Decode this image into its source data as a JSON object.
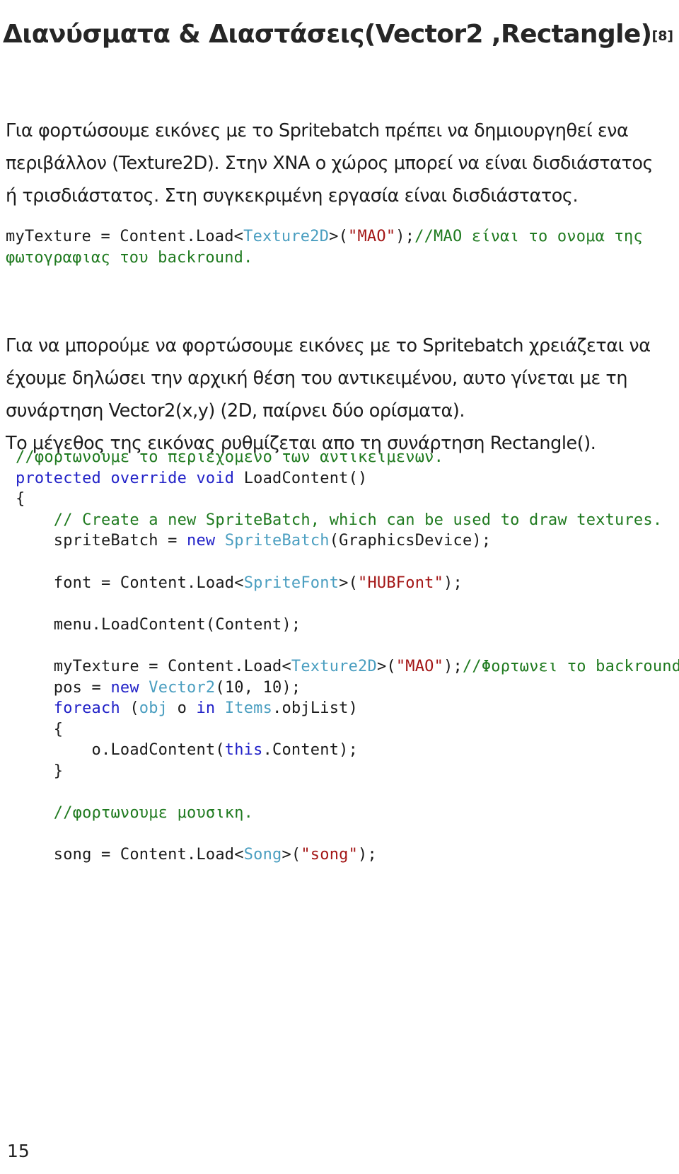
{
  "document": {
    "title": "Διανύσματα & Διαστάσεις(Vector2 ,Rectangle)",
    "title_reference": "[8]",
    "page_number": "15"
  },
  "paragraphs": {
    "p1": "Για φορτώσουμε εικόνες με το Spritebatch πρέπει να δημιουργηθεί ενα περιβάλλον (Texture2D). Στην ΧΝΑ ο χώρος μπορεί να είναι δισδιάστατος ή τρισδιάστατος. Στη συγκεκριμένη εργασία είναι δισδιάστατος.",
    "p2": "Για να μπορούμε να φορτώσουμε εικόνες με το Spritebatch χρειάζεται να έχουμε δηλώσει την αρχική θέση του αντικειμένου,  αυτο γίνεται με τη συνάρτηση Vector2(x,y) (2D, παίρνει δύο ορίσματα).",
    "p3": "Το μέγεθος της εικόνας ρυθμίζεται απο τη συνάρτηση Rectangle()."
  },
  "code_inline": {
    "tokens": [
      {
        "text": "myTexture = Content.Load<",
        "style": "plain"
      },
      {
        "text": "Texture2D",
        "style": "type"
      },
      {
        "text": ">(",
        "style": "plain"
      },
      {
        "text": "\"MAO\"",
        "style": "string"
      },
      {
        "text": ");",
        "style": "plain"
      },
      {
        "text": "//MAO είναι το ονομα της φωτογραφιας του backround.",
        "style": "comment"
      }
    ]
  },
  "code_main": {
    "lines": [
      [
        {
          "text": "//φορτωνουμε το περιεχομενο των αντικειμενων.",
          "style": "comment"
        }
      ],
      [
        {
          "text": "protected override void",
          "style": "keyword"
        },
        {
          "text": " LoadContent()",
          "style": "plain"
        }
      ],
      [
        {
          "text": "{",
          "style": "plain"
        }
      ],
      [
        {
          "text": "    // Create a new SpriteBatch, which can be used to draw textures.",
          "style": "comment"
        }
      ],
      [
        {
          "text": "    spriteBatch = ",
          "style": "plain"
        },
        {
          "text": "new",
          "style": "keyword"
        },
        {
          "text": " ",
          "style": "plain"
        },
        {
          "text": "SpriteBatch",
          "style": "type"
        },
        {
          "text": "(GraphicsDevice);",
          "style": "plain"
        }
      ],
      [
        {
          "text": "",
          "style": "plain"
        }
      ],
      [
        {
          "text": "    font = Content.Load<",
          "style": "plain"
        },
        {
          "text": "SpriteFont",
          "style": "type"
        },
        {
          "text": ">(",
          "style": "plain"
        },
        {
          "text": "\"HUBFont\"",
          "style": "string"
        },
        {
          "text": ");",
          "style": "plain"
        }
      ],
      [
        {
          "text": "",
          "style": "plain"
        }
      ],
      [
        {
          "text": "    menu.LoadContent(Content);",
          "style": "plain"
        }
      ],
      [
        {
          "text": "",
          "style": "plain"
        }
      ],
      [
        {
          "text": "    myTexture = Content.Load<",
          "style": "plain"
        },
        {
          "text": "Texture2D",
          "style": "type"
        },
        {
          "text": ">(",
          "style": "plain"
        },
        {
          "text": "\"MAO\"",
          "style": "string"
        },
        {
          "text": ");",
          "style": "plain"
        },
        {
          "text": "//Φορτωνει το backround.",
          "style": "comment"
        }
      ],
      [
        {
          "text": "    pos = ",
          "style": "plain"
        },
        {
          "text": "new",
          "style": "keyword"
        },
        {
          "text": " ",
          "style": "plain"
        },
        {
          "text": "Vector2",
          "style": "type"
        },
        {
          "text": "(10, 10);",
          "style": "plain"
        }
      ],
      [
        {
          "text": "    foreach",
          "style": "keyword"
        },
        {
          "text": " (",
          "style": "plain"
        },
        {
          "text": "obj",
          "style": "type"
        },
        {
          "text": " o ",
          "style": "plain"
        },
        {
          "text": "in",
          "style": "keyword"
        },
        {
          "text": " ",
          "style": "plain"
        },
        {
          "text": "Items",
          "style": "type"
        },
        {
          "text": ".objList)",
          "style": "plain"
        }
      ],
      [
        {
          "text": "    {",
          "style": "plain"
        }
      ],
      [
        {
          "text": "        o.LoadContent(",
          "style": "plain"
        },
        {
          "text": "this",
          "style": "keyword"
        },
        {
          "text": ".Content);",
          "style": "plain"
        }
      ],
      [
        {
          "text": "    }",
          "style": "plain"
        }
      ],
      [
        {
          "text": "",
          "style": "plain"
        }
      ],
      [
        {
          "text": "    //φορτωνουμε μουσικη.",
          "style": "comment"
        }
      ],
      [
        {
          "text": "",
          "style": "plain"
        }
      ],
      [
        {
          "text": "    song = Content.Load<",
          "style": "plain"
        },
        {
          "text": "Song",
          "style": "type"
        },
        {
          "text": ">(",
          "style": "plain"
        },
        {
          "text": "\"song\"",
          "style": "string"
        },
        {
          "text": ");",
          "style": "plain"
        }
      ]
    ]
  },
  "colors": {
    "comment": "#1f7a1f",
    "keyword": "#2222c8",
    "type": "#4a9ec0",
    "string": "#a31515",
    "plain": "#1b1b1b",
    "title": "#262626",
    "body": "#1c1c1c"
  }
}
